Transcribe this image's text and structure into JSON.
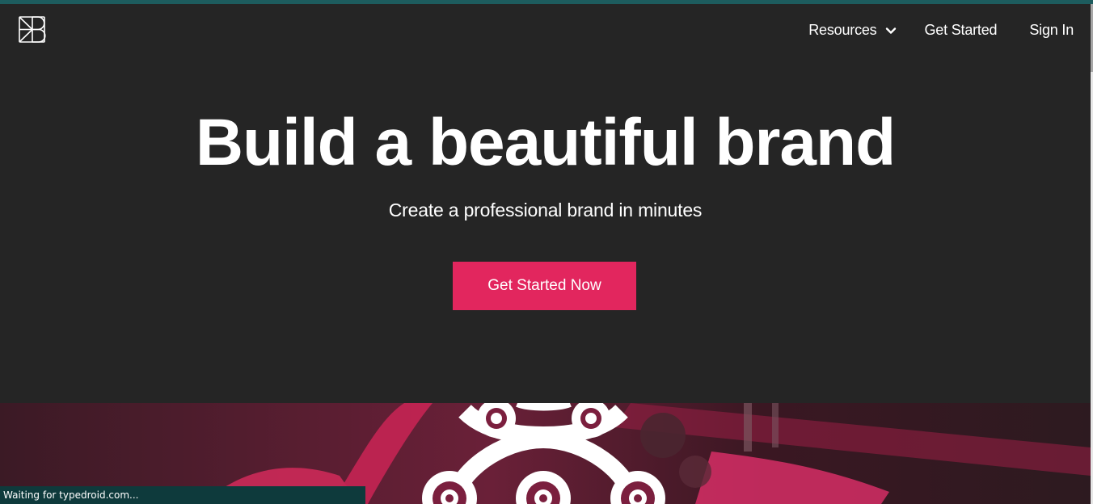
{
  "brand": {
    "logo_icon": "kb-monogram-icon"
  },
  "nav": {
    "resources_label": "Resources",
    "resources_icon": "chevron-down-icon",
    "get_started_label": "Get Started",
    "sign_in_label": "Sign In"
  },
  "hero": {
    "title": "Build a beautiful brand",
    "subtitle": "Create a professional brand in minutes",
    "cta_label": "Get Started Now"
  },
  "banner": {
    "image": "bike-chain-photo-magenta-duotone"
  },
  "status_bar": {
    "text": "Waiting for typedroid.com..."
  },
  "colors": {
    "background": "#252525",
    "accent": "#e2265e",
    "status_bar": "#0e3a3c",
    "top_accent": "#1d5c5e"
  }
}
